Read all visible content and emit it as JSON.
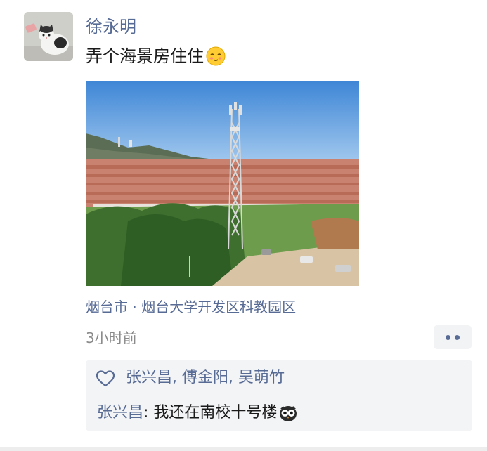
{
  "post": {
    "username": "徐永明",
    "text": "弄个海景房住住",
    "text_emoji": "shy-smile-emoji",
    "location": "烟台市 · 烟台大学开发区科教园区",
    "timestamp": "3小时前"
  },
  "likes": {
    "icon": "heart-outline-icon",
    "names": "张兴昌, 傅金阳, 吴萌竹"
  },
  "comments": [
    {
      "author": "张兴昌",
      "separator": ": ",
      "text": "我还在南校十号楼",
      "emoji": "owl-emoji"
    }
  ],
  "colors": {
    "link_blue": "#576b95",
    "interaction_bg": "#f3f4f6",
    "timestamp_gray": "#8a8a8a"
  }
}
